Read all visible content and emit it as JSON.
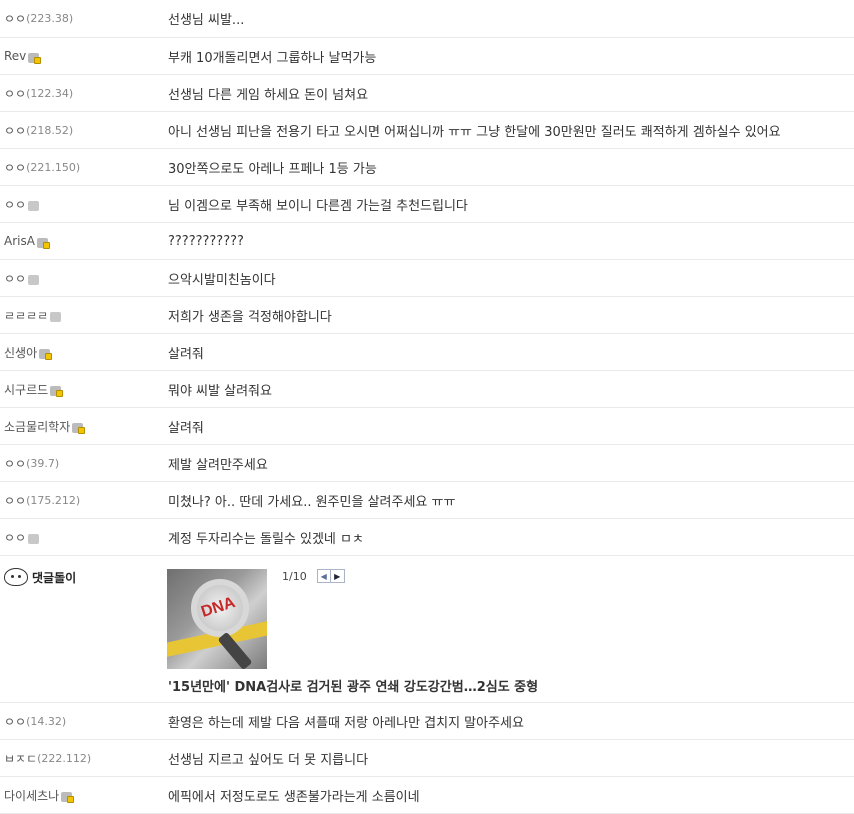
{
  "comments_top": [
    {
      "nick": "ㅇㅇ",
      "ip": "(223.38)",
      "badge": "",
      "text": "선생님 씨발..."
    },
    {
      "nick": "Rev",
      "ip": "",
      "badge": "lock",
      "text": "부캐 10개돌리면서 그룹하나 날먹가능"
    },
    {
      "nick": "ㅇㅇ",
      "ip": "(122.34)",
      "badge": "",
      "text": "선생님 다른 게임 하세요 돈이 넘쳐요"
    },
    {
      "nick": "ㅇㅇ",
      "ip": "(218.52)",
      "badge": "",
      "text": "아니 선생님 피난을 전용기 타고 오시면 어쩌십니까 ㅠㅠ 그냥 한달에 30만원만 질러도 쾌적하게 겜하실수 있어요"
    },
    {
      "nick": "ㅇㅇ",
      "ip": "(221.150)",
      "badge": "",
      "text": "30안쪽으로도 아레나 프페나 1등 가능"
    },
    {
      "nick": "ㅇㅇ",
      "ip": "",
      "badge": "plain",
      "text": "님 이겜으로 부족해 보이니 다른겜 가는걸 추천드립니다"
    },
    {
      "nick": "ArisA",
      "ip": "",
      "badge": "lock",
      "text": "???????????"
    },
    {
      "nick": "ㅇㅇ",
      "ip": "",
      "badge": "plain",
      "text": "으악시발미친놈이다"
    },
    {
      "nick": "ㄹㄹㄹㄹ",
      "ip": "",
      "badge": "plain",
      "text": "저희가 생존을 걱정해야합니다"
    },
    {
      "nick": "신생아",
      "ip": "",
      "badge": "lock",
      "text": "살려줘"
    },
    {
      "nick": "시구르드",
      "ip": "",
      "badge": "lock",
      "text": "뭐야 씨발 살려줘요"
    },
    {
      "nick": "소금물리학자",
      "ip": "",
      "badge": "lock",
      "text": "살려줘"
    },
    {
      "nick": "ㅇㅇ",
      "ip": "(39.7)",
      "badge": "",
      "text": "제발 살려만주세요"
    },
    {
      "nick": "ㅇㅇ",
      "ip": "(175.212)",
      "badge": "",
      "text": "미쳤나? 아.. 딴데 가세요.. 원주민을 살려주세요 ㅠㅠ"
    },
    {
      "nick": "ㅇㅇ",
      "ip": "",
      "badge": "plain",
      "text": "계정 두자리수는 돌릴수 있겠네 ㅁㅊ"
    }
  ],
  "bot": {
    "name": "댓글돌이",
    "pager_count": "1/10",
    "prev_icon": "◀",
    "next_icon": "▶",
    "thumb_text": "DNA",
    "headline": "'15년만에' DNA검사로 검거된 광주 연쇄 강도강간범…2심도 중형"
  },
  "comments_bottom": [
    {
      "nick": "ㅇㅇ",
      "ip": "(14.32)",
      "badge": "",
      "text": "환영은 하는데 제발 다음 셔플때 저랑 아레나만 겹치지 말아주세요"
    },
    {
      "nick": "ㅂㅈㄷ",
      "ip": "(222.112)",
      "badge": "",
      "text": "선생님 지르고 싶어도 더 못 지릅니다"
    },
    {
      "nick": "다이세츠나",
      "ip": "",
      "badge": "lock",
      "text": "에픽에서 저정도로도 생존불가라는게 소름이네"
    }
  ]
}
